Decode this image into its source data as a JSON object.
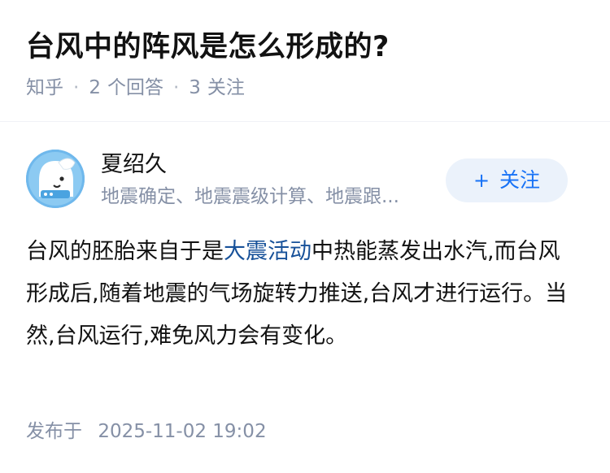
{
  "question": {
    "title": "台风中的阵风是怎么形成的?",
    "source": "知乎",
    "answer_count": "2",
    "answer_label": "个回答",
    "follower_count": "3",
    "follower_label": "关注"
  },
  "author": {
    "name": "夏绍久",
    "bio": "地震确定、地震震级计算、地震跟...",
    "follow_icon": "plus-icon",
    "follow_label": "关注"
  },
  "answer": {
    "text_before": "台风的胚胎来自于是",
    "link_text": "大震活动",
    "text_after": "中热能蒸发出水汽,而台风形成后,随着地震的气场旋转力推送,台风才进行运行。当然,台风运行,难免风力会有变化。",
    "link_color": "#175199"
  },
  "publish": {
    "label": "发布于",
    "time": "2025-11-02 19:02"
  },
  "colors": {
    "title": "#121212",
    "meta": "#8590a6",
    "accent": "#1772f6",
    "follow_bg": "#ebf2fb",
    "avatar_bg": "#6fb8ec"
  }
}
